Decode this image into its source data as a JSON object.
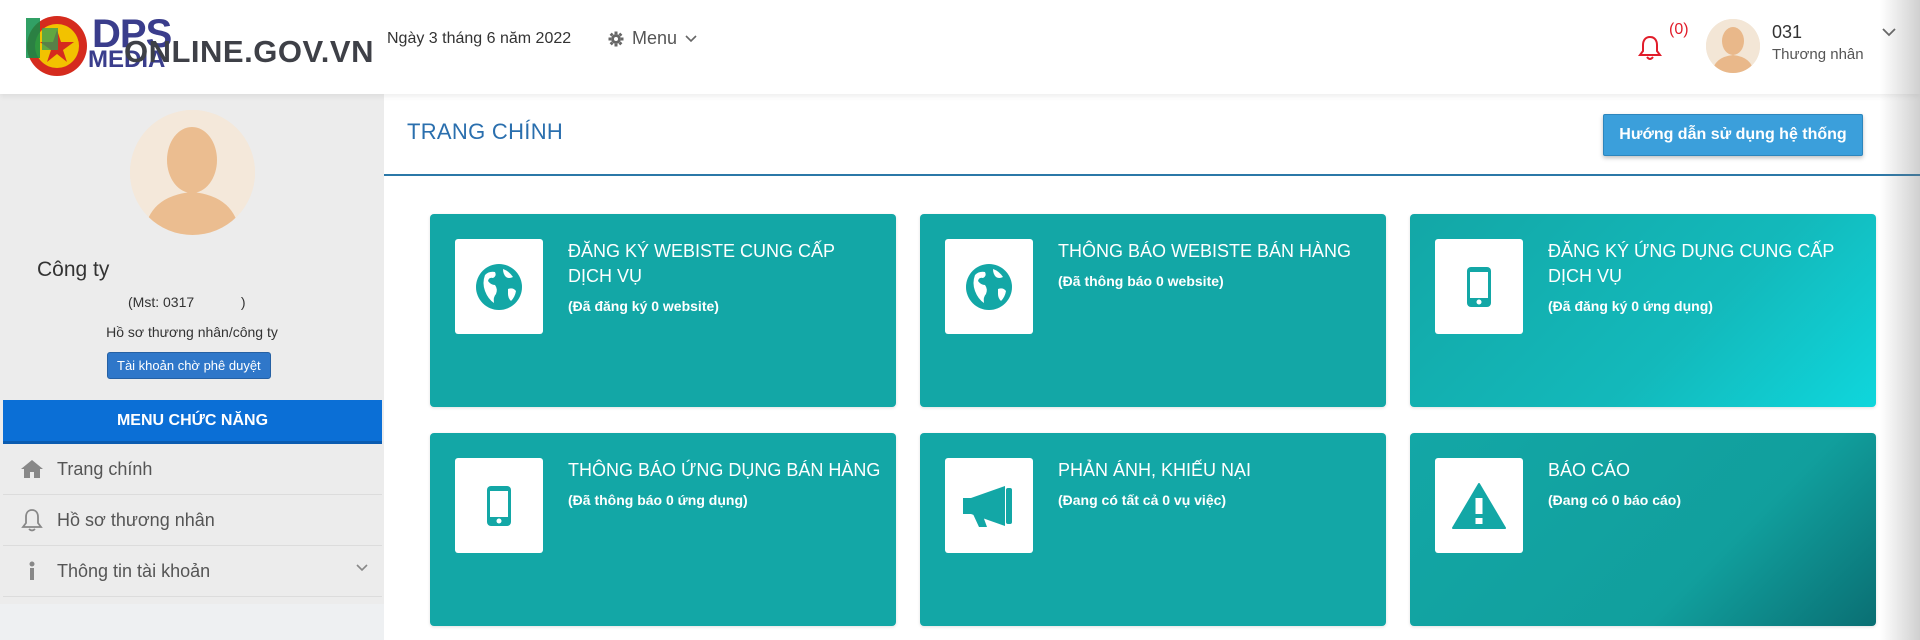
{
  "header": {
    "logo_brand": "DPS",
    "logo_brand_sub": "MEDIA",
    "site_name": "ONLINE.GOV.VN",
    "date": "Ngày 3 tháng 6 năm 2022",
    "menu_label": "Menu",
    "notification_count": "(0)",
    "user_name": "031",
    "user_role": "Thương nhân"
  },
  "sidebar": {
    "company_name": "Công ty",
    "mst": "(Mst: 0317            )",
    "profile_label": "Hồ sơ thương nhân/công ty",
    "status_badge": "Tài khoản chờ phê duyệt",
    "menu_title": "MENU CHỨC NĂNG",
    "items": [
      {
        "label": "Trang chính",
        "icon": "home-icon"
      },
      {
        "label": "Hồ sơ thương nhân",
        "icon": "bell-icon"
      },
      {
        "label": "Thông tin tài khoản",
        "icon": "info-icon"
      }
    ]
  },
  "main": {
    "page_title": "TRANG CHÍNH",
    "help_button": "Hướng dẫn sử dụng hệ thống",
    "cards": [
      {
        "title": "ĐĂNG KÝ WEBISTE CUNG CẤP DỊCH VỤ",
        "subtitle": "(Đã đăng ký 0 website)",
        "icon": "globe-icon"
      },
      {
        "title": "THÔNG BÁO WEBISTE BÁN HÀNG",
        "subtitle": "(Đã thông báo 0 website)",
        "icon": "globe-icon"
      },
      {
        "title": "ĐĂNG KÝ ỨNG DỤNG CUNG CẤP DỊCH VỤ",
        "subtitle": "(Đã đăng ký 0 ứng dụng)",
        "icon": "mobile-icon"
      },
      {
        "title": "THÔNG BÁO ỨNG DỤNG BÁN HÀNG",
        "subtitle": "(Đã thông báo 0 ứng dụng)",
        "icon": "mobile-icon"
      },
      {
        "title": "PHẢN ÁNH, KHIẾU NẠI",
        "subtitle": "(Đang có tất cả 0 vụ việc)",
        "icon": "megaphone-icon"
      },
      {
        "title": "BÁO CÁO",
        "subtitle": "(Đang có 0 báo cáo)",
        "icon": "warning-icon"
      }
    ]
  },
  "colors": {
    "card_bg": "#13a7a6",
    "primary_blue": "#0b6fd6",
    "title_blue": "#2a6fae",
    "help_button": "#3b9fdb",
    "notification_red": "#e11d2a"
  }
}
